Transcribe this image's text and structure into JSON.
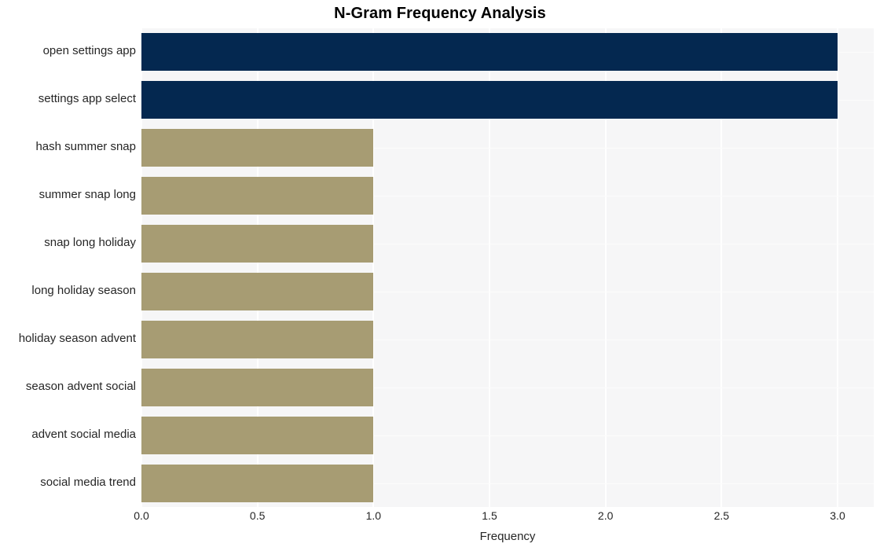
{
  "chart_data": {
    "type": "bar",
    "orientation": "horizontal",
    "title": "N-Gram Frequency Analysis",
    "xlabel": "Frequency",
    "ylabel": "",
    "categories": [
      "open settings app",
      "settings app select",
      "hash summer snap",
      "summer snap long",
      "snap long holiday",
      "long holiday season",
      "holiday season advent",
      "season advent social",
      "advent social media",
      "social media trend"
    ],
    "values": [
      3,
      3,
      1,
      1,
      1,
      1,
      1,
      1,
      1,
      1
    ],
    "bar_colors": [
      "#042850",
      "#042850",
      "#a79c73",
      "#a79c73",
      "#a79c73",
      "#a79c73",
      "#a79c73",
      "#a79c73",
      "#a79c73",
      "#a79c73"
    ],
    "xlim": [
      0,
      3.0
    ],
    "xticks": [
      0,
      0.5,
      1.0,
      1.5,
      2.0,
      2.5,
      3.0
    ],
    "xtick_labels": [
      "0.0",
      "0.5",
      "1.0",
      "1.5",
      "2.0",
      "2.5",
      "3.0"
    ],
    "grid": true,
    "grid_axis": "both",
    "legend": false,
    "plot_background": "#f6f6f7",
    "figure_background": "#ffffff",
    "gridline_color": "#ffffff",
    "text_color": "#262626"
  }
}
